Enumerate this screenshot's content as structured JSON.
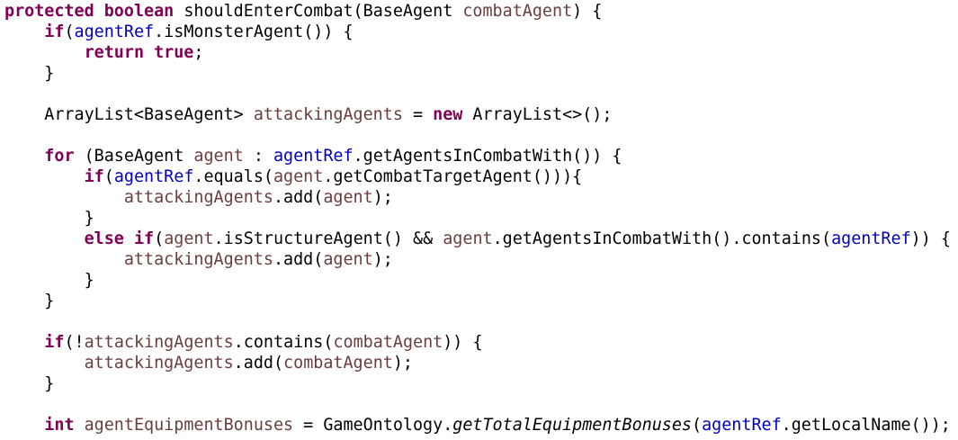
{
  "code": {
    "lines": [
      [
        {
          "t": "protected",
          "c": "kw"
        },
        {
          "t": " "
        },
        {
          "t": "boolean",
          "c": "kw"
        },
        {
          "t": " shouldEnterCombat(BaseAgent "
        },
        {
          "t": "combatAgent",
          "c": "lv"
        },
        {
          "t": ") {"
        }
      ],
      [
        {
          "t": "    "
        },
        {
          "t": "if",
          "c": "kw"
        },
        {
          "t": "("
        },
        {
          "t": "agentRef",
          "c": "fld"
        },
        {
          "t": ".isMonsterAgent()) {"
        }
      ],
      [
        {
          "t": "        "
        },
        {
          "t": "return",
          "c": "kw"
        },
        {
          "t": " "
        },
        {
          "t": "true",
          "c": "kw"
        },
        {
          "t": ";"
        }
      ],
      [
        {
          "t": "    }"
        }
      ],
      [],
      [
        {
          "t": "    ArrayList<BaseAgent> "
        },
        {
          "t": "attackingAgents",
          "c": "lv"
        },
        {
          "t": " = "
        },
        {
          "t": "new",
          "c": "kw"
        },
        {
          "t": " ArrayList<>();"
        }
      ],
      [],
      [
        {
          "t": "    "
        },
        {
          "t": "for",
          "c": "kw"
        },
        {
          "t": " (BaseAgent "
        },
        {
          "t": "agent",
          "c": "lv"
        },
        {
          "t": " : "
        },
        {
          "t": "agentRef",
          "c": "fld"
        },
        {
          "t": ".getAgentsInCombatWith()) {"
        }
      ],
      [
        {
          "t": "        "
        },
        {
          "t": "if",
          "c": "kw"
        },
        {
          "t": "("
        },
        {
          "t": "agentRef",
          "c": "fld"
        },
        {
          "t": ".equals("
        },
        {
          "t": "agent",
          "c": "lv"
        },
        {
          "t": ".getCombatTargetAgent())){"
        }
      ],
      [
        {
          "t": "            "
        },
        {
          "t": "attackingAgents",
          "c": "lv"
        },
        {
          "t": ".add("
        },
        {
          "t": "agent",
          "c": "lv"
        },
        {
          "t": ");"
        }
      ],
      [
        {
          "t": "        }"
        }
      ],
      [
        {
          "t": "        "
        },
        {
          "t": "else",
          "c": "kw"
        },
        {
          "t": " "
        },
        {
          "t": "if",
          "c": "kw"
        },
        {
          "t": "("
        },
        {
          "t": "agent",
          "c": "lv"
        },
        {
          "t": ".isStructureAgent() && "
        },
        {
          "t": "agent",
          "c": "lv"
        },
        {
          "t": ".getAgentsInCombatWith().contains("
        },
        {
          "t": "agentRef",
          "c": "fld"
        },
        {
          "t": ")) {"
        }
      ],
      [
        {
          "t": "            "
        },
        {
          "t": "attackingAgents",
          "c": "lv"
        },
        {
          "t": ".add("
        },
        {
          "t": "agent",
          "c": "lv"
        },
        {
          "t": ");"
        }
      ],
      [
        {
          "t": "        }"
        }
      ],
      [
        {
          "t": "    }"
        }
      ],
      [],
      [
        {
          "t": "    "
        },
        {
          "t": "if",
          "c": "kw"
        },
        {
          "t": "(!"
        },
        {
          "t": "attackingAgents",
          "c": "lv"
        },
        {
          "t": ".contains("
        },
        {
          "t": "combatAgent",
          "c": "lv"
        },
        {
          "t": ")) {"
        }
      ],
      [
        {
          "t": "        "
        },
        {
          "t": "attackingAgents",
          "c": "lv"
        },
        {
          "t": ".add("
        },
        {
          "t": "combatAgent",
          "c": "lv"
        },
        {
          "t": ");"
        }
      ],
      [
        {
          "t": "    }"
        }
      ],
      [],
      [
        {
          "t": "    "
        },
        {
          "t": "int",
          "c": "kw"
        },
        {
          "t": " "
        },
        {
          "t": "agentEquipmentBonuses",
          "c": "lv"
        },
        {
          "t": " = GameOntology."
        },
        {
          "t": "getTotalEquipmentBonuses",
          "c": "st"
        },
        {
          "t": "("
        },
        {
          "t": "agentRef",
          "c": "fld"
        },
        {
          "t": ".getLocalName());"
        }
      ]
    ]
  },
  "colors": {
    "background": "#ffffff",
    "keyword": "#7f0055",
    "field": "#0000c0",
    "local_variable": "#6a3e3e",
    "default_text": "#000000"
  }
}
